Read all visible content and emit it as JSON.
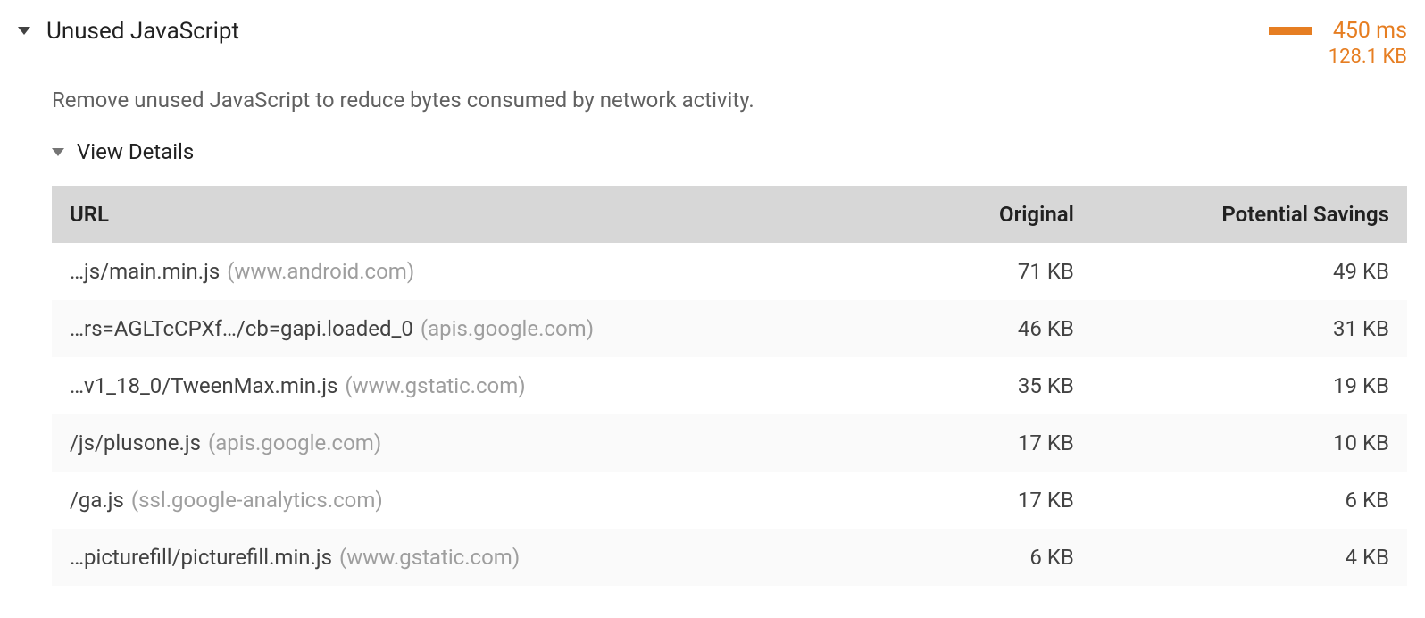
{
  "audit": {
    "title": "Unused JavaScript",
    "time": "450 ms",
    "size": "128.1 KB",
    "description": "Remove unused JavaScript to reduce bytes consumed by network activity.",
    "details_label": "View Details"
  },
  "table": {
    "headers": {
      "url": "URL",
      "original": "Original",
      "savings": "Potential Savings"
    },
    "rows": [
      {
        "path": "…js/main.min.js",
        "domain": "(www.android.com)",
        "original": "71 KB",
        "savings": "49 KB"
      },
      {
        "path": "…rs=AGLTcCPXf…/cb=gapi.loaded_0",
        "domain": "(apis.google.com)",
        "original": "46 KB",
        "savings": "31 KB"
      },
      {
        "path": "…v1_18_0/TweenMax.min.js",
        "domain": "(www.gstatic.com)",
        "original": "35 KB",
        "savings": "19 KB"
      },
      {
        "path": "/js/plusone.js",
        "domain": "(apis.google.com)",
        "original": "17 KB",
        "savings": "10 KB"
      },
      {
        "path": "/ga.js",
        "domain": "(ssl.google-analytics.com)",
        "original": "17 KB",
        "savings": "6 KB"
      },
      {
        "path": "…picturefill/picturefill.min.js",
        "domain": "(www.gstatic.com)",
        "original": "6 KB",
        "savings": "4 KB"
      }
    ]
  }
}
